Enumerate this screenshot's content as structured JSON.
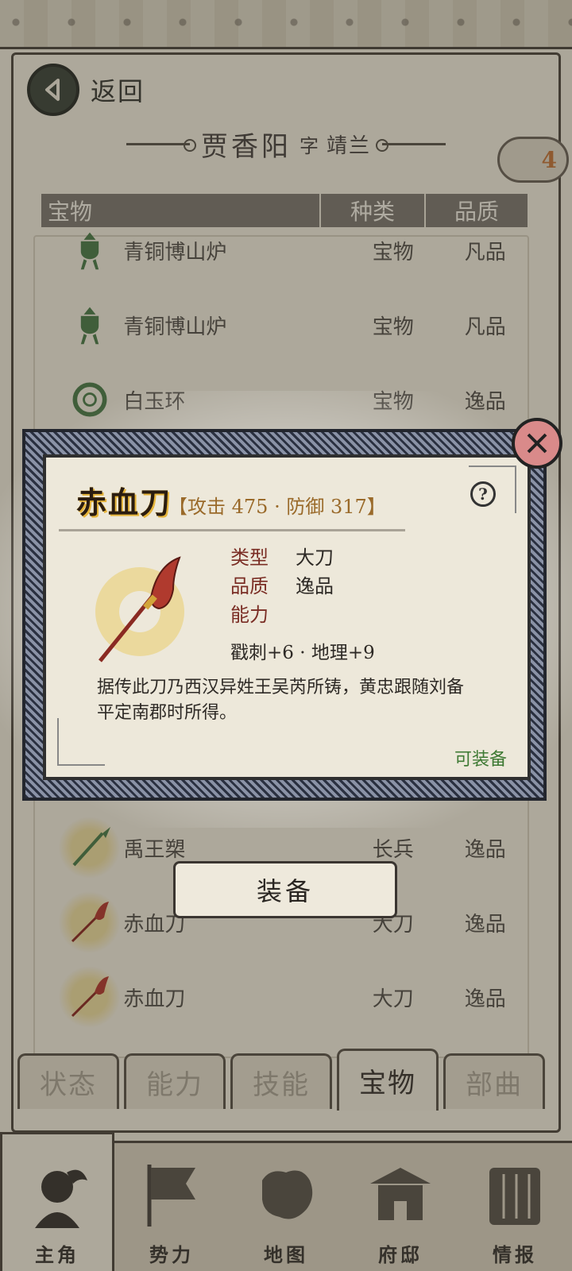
{
  "header": {
    "back_label": "返回",
    "character_name": "贾香阳",
    "zi_label": "字",
    "courtesy_name": "靖兰",
    "badge_count": "4"
  },
  "table": {
    "columns": [
      "宝物",
      "种类",
      "品质"
    ],
    "rows": [
      {
        "name": "青铜博山炉",
        "kind": "宝物",
        "quality": "凡品",
        "icon": "bronze-censer-icon"
      },
      {
        "name": "青铜博山炉",
        "kind": "宝物",
        "quality": "凡品",
        "icon": "bronze-censer-icon"
      },
      {
        "name": "白玉环",
        "kind": "宝物",
        "quality": "逸品",
        "icon": "jade-ring-icon"
      },
      {
        "name": "禹王槊",
        "kind": "长兵",
        "quality": "逸品",
        "icon": "spear-icon"
      },
      {
        "name": "赤血刀",
        "kind": "大刀",
        "quality": "逸品",
        "icon": "broadsword-icon"
      },
      {
        "name": "赤血刀",
        "kind": "大刀",
        "quality": "逸品",
        "icon": "broadsword-icon"
      }
    ]
  },
  "tabs": [
    "状态",
    "能力",
    "技能",
    "宝物",
    "部曲"
  ],
  "active_tab": "宝物",
  "bottom_nav": [
    "主角",
    "势力",
    "地图",
    "府邸",
    "情报"
  ],
  "dialog": {
    "item_name": "赤血刀",
    "stats": "【攻击 475 · 防御 317】",
    "attr_type_key": "类型",
    "attr_type_val": "大刀",
    "attr_quality_key": "品质",
    "attr_quality_val": "逸品",
    "attr_ability_key": "能力",
    "abilities": "戳刺+6 · 地理+9",
    "description": "据传此刀乃西汉异姓王吴芮所铸，黄忠跟随刘备平定南郡时所得。",
    "equipable": "可装备",
    "equip_button": "装备"
  },
  "colors": {
    "accent_gold": "#e6b43a",
    "attr_key": "#7a2d24",
    "equipable_green": "#3f7a34",
    "close_red": "#d98a8a"
  }
}
